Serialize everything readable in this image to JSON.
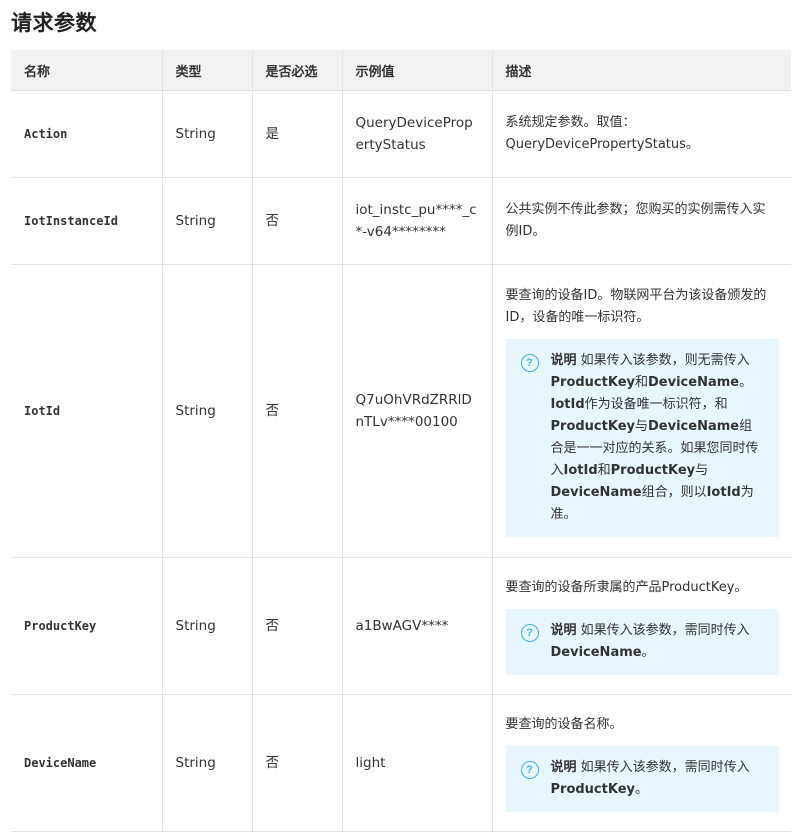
{
  "page_title": "请求参数",
  "columns": [
    "名称",
    "类型",
    "是否必选",
    "示例值",
    "描述"
  ],
  "rows": [
    {
      "name": "Action",
      "type": "String",
      "required": "是",
      "example": "QueryDevicePropertyStatus",
      "desc": "系统规定参数。取值：QueryDevicePropertyStatus。"
    },
    {
      "name": "IotInstanceId",
      "type": "String",
      "required": "否",
      "example": "iot_instc_pu****_c*-v64********",
      "desc": "公共实例不传此参数；您购买的实例需传入实例ID。"
    },
    {
      "name": "IotId",
      "type": "String",
      "required": "否",
      "example": "Q7uOhVRdZRRlDnTLv****00100",
      "desc": "要查询的设备ID。物联网平台为该设备颁发的ID，设备的唯一标识符。",
      "note": {
        "label": "说明",
        "parts": [
          "如果传入该参数，则无需传入",
          "ProductKey",
          "和",
          "DeviceName",
          "。",
          "IotId",
          "作为设备唯一标识符，和",
          "ProductKey",
          "与",
          "DeviceName",
          "组合是一一对应的关系。如果您同时传入",
          "IotId",
          "和",
          "ProductKey",
          "与",
          "DeviceName",
          "组合，则以",
          "IotId",
          "为准。"
        ]
      }
    },
    {
      "name": "ProductKey",
      "type": "String",
      "required": "否",
      "example": "a1BwAGV****",
      "desc": "要查询的设备所隶属的产品ProductKey。",
      "note": {
        "label": "说明",
        "parts": [
          "如果传入该参数，需同时传入",
          "DeviceName",
          "。"
        ]
      }
    },
    {
      "name": "DeviceName",
      "type": "String",
      "required": "否",
      "example": "light",
      "desc": "要查询的设备名称。",
      "note": {
        "label": "说明",
        "parts": [
          "如果传入该参数，需同时传入",
          "ProductKey",
          "。"
        ]
      }
    }
  ],
  "icons": {
    "note_icon": "question-circle-icon"
  },
  "colors": {
    "header_bg": "#f2f2f2",
    "note_bg": "#e8f6fd",
    "note_icon": "#3fb3e5",
    "border": "#e3e3e3"
  }
}
